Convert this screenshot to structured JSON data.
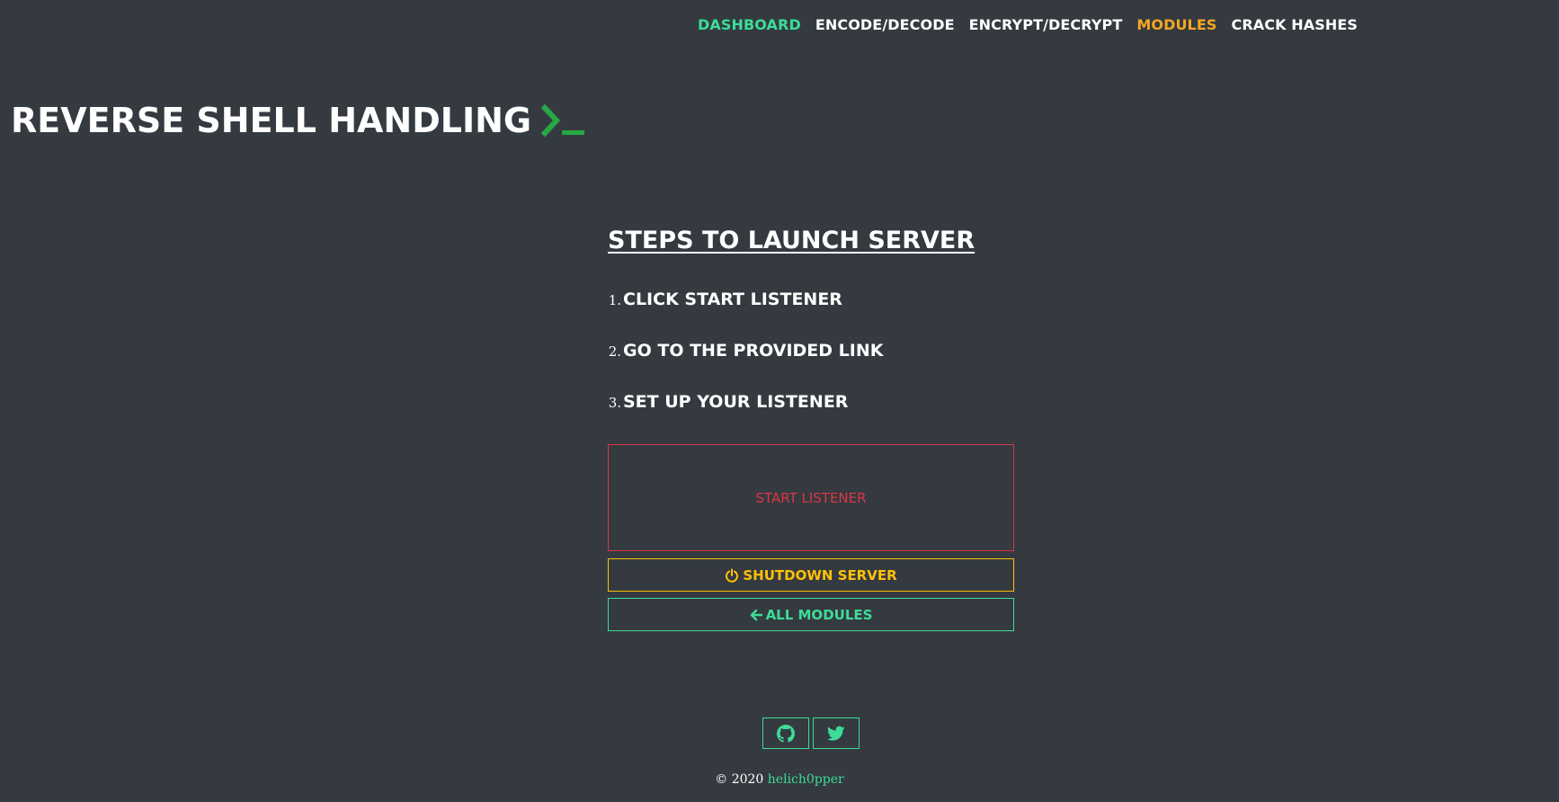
{
  "nav": {
    "items": [
      {
        "label": "DASHBOARD",
        "color": "#3ddc97"
      },
      {
        "label": "ENCODE/DECODE",
        "color": "#ffffff"
      },
      {
        "label": "ENCRYPT/DECRYPT",
        "color": "#ffffff"
      },
      {
        "label": "MODULES",
        "color": "#f5a623"
      },
      {
        "label": "CRACK HASHES",
        "color": "#ffffff"
      }
    ]
  },
  "header": {
    "title": "REVERSE SHELL HANDLING",
    "title_icon": "terminal-prompt-icon"
  },
  "steps": {
    "heading": "STEPS TO LAUNCH SERVER",
    "items": [
      {
        "number": "1.",
        "text": "CLICK START LISTENER"
      },
      {
        "number": "2.",
        "text": "GO TO THE PROVIDED LINK"
      },
      {
        "number": "3.",
        "text": "SET UP YOUR LISTENER"
      }
    ]
  },
  "actions": {
    "start_label": "START LISTENER",
    "shutdown_label": "SHUTDOWN SERVER",
    "shutdown_icon": "power-icon",
    "modules_label": "ALL MODULES",
    "modules_icon": "arrow-left-icon"
  },
  "social": {
    "github_icon": "github-icon",
    "twitter_icon": "twitter-icon"
  },
  "footer": {
    "copyright": "© 2020",
    "author": "helich0pper"
  },
  "colors": {
    "background": "#343a40",
    "accent": "#3ddc97",
    "danger": "#dc3545",
    "warning": "#ffc107",
    "modules": "#f5a623",
    "prompt": "#28a745"
  }
}
